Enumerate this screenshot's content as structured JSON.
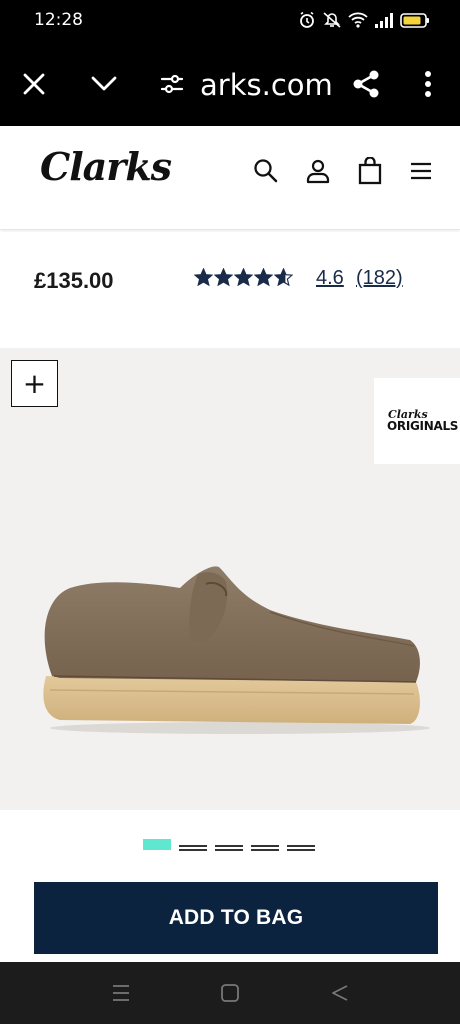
{
  "status_bar": {
    "time": "12:28",
    "icons": [
      "alarm-icon",
      "mute-icon",
      "wifi-icon",
      "signal-icon",
      "battery-icon"
    ]
  },
  "browser": {
    "url": "arks.com",
    "buttons": [
      "close-icon",
      "chevron-down-icon",
      "site-settings-icon",
      "share-icon",
      "more-icon"
    ]
  },
  "header": {
    "logo": "Clarks",
    "icons": [
      "search-icon",
      "account-icon",
      "bag-icon",
      "menu-icon"
    ]
  },
  "product": {
    "price": "£135.00",
    "stars": 4.6,
    "rating": "4.6",
    "reviews": "(182)"
  },
  "gallery": {
    "zoom_label": "+",
    "badge": {
      "top": "Clarks",
      "main": "ORIGINALS"
    },
    "slide_count": 5,
    "active_slide": 0
  },
  "cta": {
    "add_to_bag": "ADD TO BAG"
  },
  "colors": {
    "navy": "#0c2340",
    "accent": "#5fe8cf",
    "star": "#1a2b4a"
  },
  "system_nav": [
    "recents-icon",
    "home-icon",
    "back-icon"
  ]
}
